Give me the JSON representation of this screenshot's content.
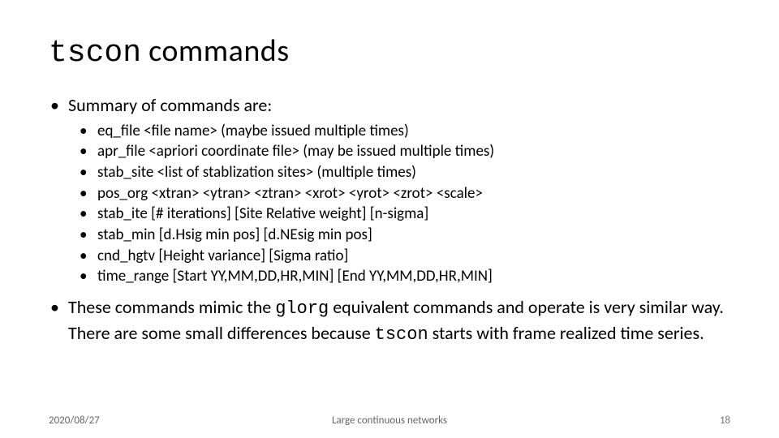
{
  "title": {
    "code": "tscon",
    "rest": " commands"
  },
  "bullets": {
    "summary_intro": "Summary of commands are:",
    "commands": [
      "eq_file <file name>  (maybe issued multiple times)",
      "apr_file <apriori coordinate file> (may be issued multiple times)",
      "stab_site <list of stablization sites> (multiple times)",
      "pos_org <xtran> <ytran> <ztran> <xrot> <yrot> <zrot> <scale>",
      "stab_ite [# iterations] [Site Relative weight] [n-sigma]",
      "stab_min [d.Hsig min pos] [d.NEsig min pos]",
      "cnd_hgtv [Height variance] [Sigma ratio]",
      "time_range [Start YY,MM,DD,HR,MIN] [End YY,MM,DD,HR,MIN]"
    ],
    "closing": {
      "pre": "These commands mimic the ",
      "code1": "glorg",
      "mid": " equivalent commands and operate is very similar way.  There are some small differences because ",
      "code2": "tscon",
      "post": " starts with frame realized time series."
    }
  },
  "footer": {
    "date": "2020/08/27",
    "center": "Large continuous networks",
    "page": "18"
  }
}
